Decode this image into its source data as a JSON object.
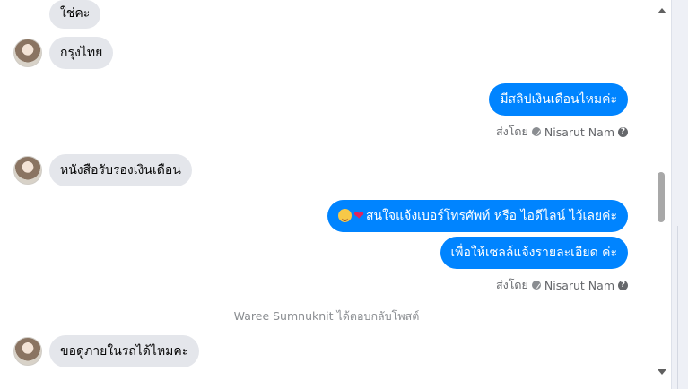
{
  "messages": {
    "m1": "ใช่คะ",
    "m2": "กรุงไทย",
    "m3": "มีสลิปเงินเดือนไหมค่ะ",
    "m4": "หนังสือรับรองเงินเดือน",
    "m5_text": "สนใจแจ้งเบอร์โทรศัพท์ หรือ ไอดีไลน์  ไว้เลยค่ะ",
    "m5_emoji_1": "🥰",
    "m5_emoji_2": "❤",
    "m6": "เพื่อให้เซลล์แจ้งรายละเอียด ค่ะ",
    "m7": "ขอดูภายในรถได้ไหมคะ"
  },
  "sent_by": {
    "prefix": "ส่งโดย",
    "name": "Nisarut Nam",
    "help": "?"
  },
  "notice": "Waree Sumnuknit ได้ตอบกลับโพสต์",
  "colors": {
    "outgoing": "#0084ff",
    "incoming": "#e4e6eb",
    "meta": "#65676b"
  },
  "icons": {
    "verified": "check-circle-icon",
    "help": "question-circle-icon",
    "scroll_up": "arrow-up-icon",
    "scroll_down": "arrow-down-icon"
  }
}
